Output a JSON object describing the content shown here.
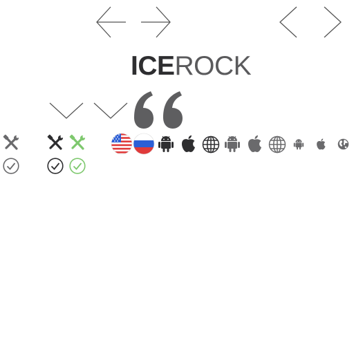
{
  "logo": {
    "bold": "ICE",
    "light": "ROCK"
  },
  "colors": {
    "dark": "#2e2e30",
    "gray": "#5e5e60",
    "light_gray": "#8a8a8c",
    "green": "#7ec86e",
    "line": "#555555",
    "flag_red": "#e03a3a",
    "flag_blue": "#2c5fd6"
  },
  "icons": [
    "arrow-left-icon",
    "arrow-right-icon",
    "chevron-left-icon",
    "chevron-right-icon",
    "chevron-down-icon",
    "quote-icon",
    "tools-icon",
    "check-circle-icon",
    "us-flag-icon",
    "russia-flag-icon",
    "android-icon",
    "apple-icon",
    "globe-icon"
  ]
}
